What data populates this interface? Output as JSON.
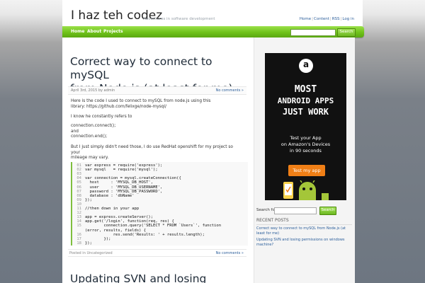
{
  "site": {
    "title": "I haz teh codez",
    "description": "Adventures in software development"
  },
  "top_nav": [
    "Home",
    "Content",
    "RSS",
    "Log in"
  ],
  "main_nav": [
    "Home",
    "About",
    "Projects"
  ],
  "nav_search": {
    "button": "Search",
    "value": ""
  },
  "post1": {
    "title_line1": "Correct way to connect to mySQL",
    "title_line2": "from Node.js (at least for me)",
    "meta": "April 3rd, 2015 by admin",
    "comments_top": "No comments »",
    "para1_line1": "Here is the code I used to connect to mySQL from node.js using this",
    "para1_line2": "library: https://github.com/felixge/node-mysql/",
    "para2": "I know he constantly refers to",
    "code_line_a": "connection.connect();",
    "code_line_and": "and",
    "code_line_b": "connection.end();",
    "para3_line1": "But I just simply didn't need those, I do use RedHat openshift for my project so your",
    "para3_line2": "mileage may vary.",
    "code": [
      {
        "n": "01",
        "t": "var express = require('express');"
      },
      {
        "n": "02",
        "t": "var mysql   = require('mysql');"
      },
      {
        "n": "03",
        "t": ""
      },
      {
        "n": "04",
        "t": "var connection = mysql.createConnection({"
      },
      {
        "n": "05",
        "t": "  host     : 'MYSQL_DB_HOST',"
      },
      {
        "n": "06",
        "t": "  user     : 'MYSQL_DB_USERNAME',"
      },
      {
        "n": "07",
        "t": "  password : 'MYSQL_DB_PASSWORD',"
      },
      {
        "n": "08",
        "t": "  database : 'dbName'"
      },
      {
        "n": "09",
        "t": "});"
      },
      {
        "n": "10",
        "t": ""
      },
      {
        "n": "11",
        "t": "//then down in your app"
      },
      {
        "n": "12",
        "t": ""
      },
      {
        "n": "13",
        "t": "app = express.createServer();"
      },
      {
        "n": "14",
        "t": "app.get('/login', function(req, res) {"
      },
      {
        "n": "15",
        "t": "        connection.query('SELECT * FROM `Users`', function"
      },
      {
        "n": "",
        "t": "(error, results, fields) {"
      },
      {
        "n": "16",
        "t": "            res.send('Results: ' + results.length);"
      },
      {
        "n": "17",
        "t": "        });"
      },
      {
        "n": "18",
        "t": "});"
      }
    ],
    "posted_in": "Posted in Uncategorized",
    "comments_bottom": "No comments »"
  },
  "post2": {
    "title": "Updating SVN and losing"
  },
  "ad": {
    "logo_letter": "a",
    "headline": [
      "MOST",
      "ANDROID APPS",
      "JUST WORK"
    ],
    "sub": [
      "Test your App",
      "on Amazon's Devices",
      "in 90 seconds"
    ],
    "cta": "Test my app"
  },
  "sidebar": {
    "search_label": "Search for:",
    "search_button": "Search",
    "search_value": "",
    "recent_title": "RECENT POSTS",
    "recent_posts": [
      "Correct way to connect to mySQL from Node.js (at least for me)",
      "Updating SVN and losing permissions on windows machine?"
    ]
  },
  "colors": {
    "nav_green": "#6fc21a",
    "link_blue": "#2a5d9a",
    "ad_orange": "#f07f16",
    "android_green": "#a4c639"
  }
}
